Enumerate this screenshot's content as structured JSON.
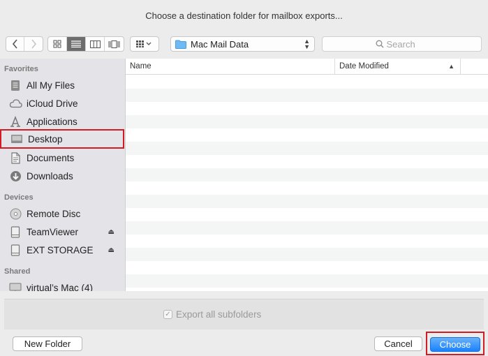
{
  "dialog": {
    "title": "Choose a destination folder for mailbox exports..."
  },
  "toolbar": {
    "back_icon": "chevron-left-icon",
    "forward_icon": "chevron-right-icon",
    "view_icons": [
      "icon-view-icon",
      "list-view-icon",
      "column-view-icon",
      "cover-flow-icon"
    ],
    "active_view": "list-view-icon",
    "arrange_icon": "arrange-grid-icon",
    "location": "Mac Mail Data",
    "search_placeholder": "Search"
  },
  "sidebar": {
    "favorites_header": "Favorites",
    "favorites": [
      {
        "label": "All My Files",
        "icon": "all-files-icon"
      },
      {
        "label": "iCloud Drive",
        "icon": "cloud-icon"
      },
      {
        "label": "Applications",
        "icon": "applications-icon"
      },
      {
        "label": "Desktop",
        "icon": "desktop-icon",
        "highlighted": true
      },
      {
        "label": "Documents",
        "icon": "documents-icon"
      },
      {
        "label": "Downloads",
        "icon": "downloads-icon"
      }
    ],
    "devices_header": "Devices",
    "devices": [
      {
        "label": "Remote Disc",
        "icon": "disc-icon"
      },
      {
        "label": "TeamViewer",
        "icon": "drive-icon",
        "ejectable": true
      },
      {
        "label": "EXT STORAGE",
        "icon": "drive-icon",
        "ejectable": true
      }
    ],
    "shared_header": "Shared",
    "shared": [
      {
        "label": "virtual’s Mac (4)",
        "icon": "computer-icon"
      }
    ]
  },
  "file_list": {
    "columns": [
      "Name",
      "Date Modified"
    ],
    "sort_indicator": "sort-ascending-icon"
  },
  "options": {
    "export_subfolders_label": "Export all subfolders",
    "export_subfolders_checked": true
  },
  "buttons": {
    "new_folder": "New Folder",
    "cancel": "Cancel",
    "choose": "Choose"
  },
  "colors": {
    "accent": "#1a82fb",
    "highlight_box": "#d21b24"
  }
}
